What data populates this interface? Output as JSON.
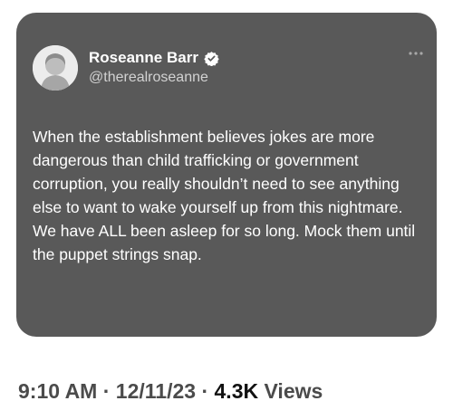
{
  "tweet": {
    "display_name": "Roseanne Barr",
    "handle": "@therealroseanne",
    "more_icon": "more-options-icon",
    "verified_icon": "verified-badge-icon",
    "text": "When the establishment believes jokes are more dangerous than child trafficking or government corruption, you really shouldn’t need to see anything else to want to wake yourself up from this nightmare. We have ALL been asleep for so long. Mock them until the puppet strings snap."
  },
  "meta": {
    "time": "9:10 AM",
    "separator_1": " · ",
    "date": "12/11/23",
    "separator_2": " · ",
    "views_count": "4.3K",
    "views_label": " Views"
  },
  "colors": {
    "card_background": "#595959",
    "text_primary": "#ffffff",
    "text_secondary": "#d2d2d2",
    "meta_text": "#4b4b4b"
  }
}
